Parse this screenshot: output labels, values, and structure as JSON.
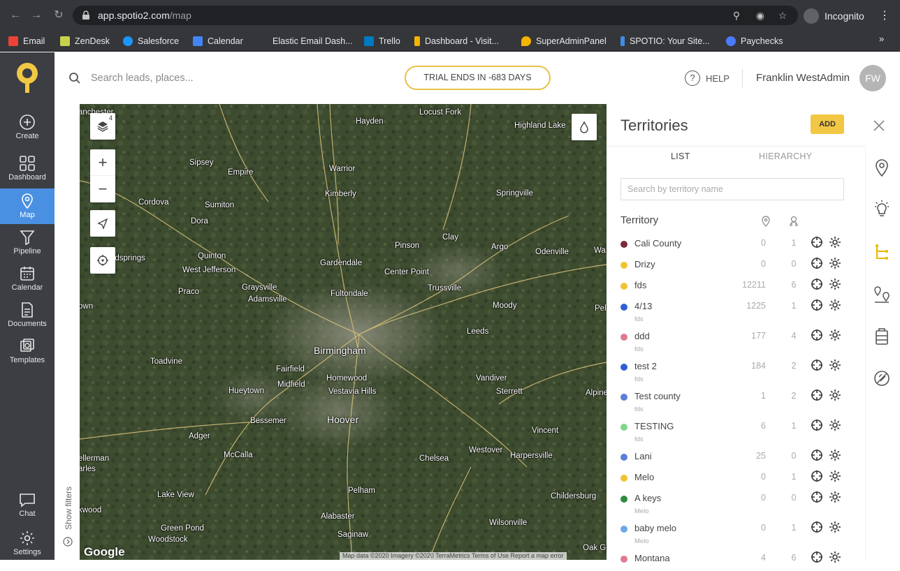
{
  "browser": {
    "url_host": "app.spotio2.com",
    "url_path": "/map",
    "profile_label": "Incognito",
    "bookmarks": [
      {
        "label": "Email",
        "color": "#ea4335"
      },
      {
        "label": "ZenDesk",
        "color": "#c6d24b"
      },
      {
        "label": "Salesforce",
        "color": "#1b96ff"
      },
      {
        "label": "Calendar",
        "color": "#4285f4"
      },
      {
        "label": "Elastic Email Dash...",
        "color": "#35363a"
      },
      {
        "label": "Trello",
        "color": "#0079bf"
      },
      {
        "label": "Dashboard - Visit...",
        "color": "#f4b400"
      },
      {
        "label": "SuperAdminPanel",
        "color": "#f4b400"
      },
      {
        "label": "SPOTIO: Your Site...",
        "color": "#3a8ee6"
      },
      {
        "label": "Paychecks",
        "color": "#4a7bff"
      }
    ],
    "more_label": "»"
  },
  "sidebar": {
    "items": [
      {
        "label": "Create",
        "icon": "plus-circle-icon"
      },
      {
        "label": "Dashboard",
        "icon": "grid-icon"
      },
      {
        "label": "Map",
        "icon": "map-pin-icon"
      },
      {
        "label": "Pipeline",
        "icon": "funnel-icon"
      },
      {
        "label": "Calendar",
        "icon": "calendar-icon"
      },
      {
        "label": "Documents",
        "icon": "document-icon"
      },
      {
        "label": "Templates",
        "icon": "templates-icon"
      }
    ],
    "bottom": [
      {
        "label": "Chat",
        "icon": "chat-icon"
      },
      {
        "label": "Settings",
        "icon": "gear-icon"
      }
    ]
  },
  "header": {
    "search_placeholder": "Search leads, places...",
    "trial_label": "TRIAL ENDS IN -683 DAYS",
    "help_label": "HELP",
    "user_name": "Franklin WestAdmin",
    "user_initials": "FW"
  },
  "map": {
    "layers_count": "4",
    "show_filters_label": "Show filters",
    "google_label": "Google",
    "attribution": "Map data ©2020 Imagery ©2020 TerraMetrics    Terms of Use    Report a map error",
    "cities": [
      {
        "name": "Locust Fork"
      },
      {
        "name": "Hayden"
      },
      {
        "name": "Highland Lake"
      },
      {
        "name": "Sipsey"
      },
      {
        "name": "Empire"
      },
      {
        "name": "Warrior"
      },
      {
        "name": "Kimberly"
      },
      {
        "name": "Springville"
      },
      {
        "name": "Cordova"
      },
      {
        "name": "Sumiton"
      },
      {
        "name": "Dora"
      },
      {
        "name": "Pinson"
      },
      {
        "name": "Clay"
      },
      {
        "name": "Argo"
      },
      {
        "name": "Odenville"
      },
      {
        "name": "Quinton"
      },
      {
        "name": "West Jefferson"
      },
      {
        "name": "Gardendale"
      },
      {
        "name": "Center Point"
      },
      {
        "name": "Praco"
      },
      {
        "name": "Graysville"
      },
      {
        "name": "Adamsville"
      },
      {
        "name": "Fultondale"
      },
      {
        "name": "Trussville"
      },
      {
        "name": "Moody"
      },
      {
        "name": "Leeds"
      },
      {
        "name": "Birmingham"
      },
      {
        "name": "Toadvine"
      },
      {
        "name": "Fairfield"
      },
      {
        "name": "Midfield"
      },
      {
        "name": "Homewood"
      },
      {
        "name": "Vestavia Hills"
      },
      {
        "name": "Vandiver"
      },
      {
        "name": "Sterrett"
      },
      {
        "name": "Hueytown"
      },
      {
        "name": "Bessemer"
      },
      {
        "name": "Hoover"
      },
      {
        "name": "Adger"
      },
      {
        "name": "Vincent"
      },
      {
        "name": "McCalla"
      },
      {
        "name": "Chelsea"
      },
      {
        "name": "Westover"
      },
      {
        "name": "Harpersville"
      },
      {
        "name": "Lake View"
      },
      {
        "name": "Pelham"
      },
      {
        "name": "Childersburg"
      },
      {
        "name": "Alabaster"
      },
      {
        "name": "Wilsonville"
      },
      {
        "name": "Green Pond"
      },
      {
        "name": "Woodstock"
      },
      {
        "name": "Saginaw"
      },
      {
        "name": "anchester"
      },
      {
        "name": "odsprings"
      },
      {
        "name": "own"
      },
      {
        "name": "Pel"
      },
      {
        "name": "Alpine"
      },
      {
        "name": "Wa"
      },
      {
        "name": "ellerman"
      },
      {
        "name": "arles"
      },
      {
        "name": "kwood"
      },
      {
        "name": "Oak Gr"
      }
    ]
  },
  "panel": {
    "title": "Territories",
    "add_label": "ADD",
    "tab_list": "LIST",
    "tab_hierarchy": "HIERARCHY",
    "search_placeholder": "Search by territory name",
    "col_territory": "Territory",
    "rows": [
      {
        "name": "Cali County",
        "sub": "",
        "count1": "0",
        "count2": "1",
        "color": "#7a2a3a"
      },
      {
        "name": "Drizy",
        "sub": "",
        "count1": "0",
        "count2": "0",
        "color": "#f0c431"
      },
      {
        "name": "fds",
        "sub": "",
        "count1": "12211",
        "count2": "6",
        "color": "#f0c431"
      },
      {
        "name": "4/13",
        "sub": "fds",
        "count1": "1225",
        "count2": "1",
        "color": "#2f5ed6"
      },
      {
        "name": "ddd",
        "sub": "fds",
        "count1": "177",
        "count2": "4",
        "color": "#e07a8e"
      },
      {
        "name": "test 2",
        "sub": "fds",
        "count1": "184",
        "count2": "2",
        "color": "#2f5ed6"
      },
      {
        "name": "Test county",
        "sub": "fds",
        "count1": "1",
        "count2": "2",
        "color": "#5b7fd6"
      },
      {
        "name": "TESTING",
        "sub": "fds",
        "count1": "6",
        "count2": "1",
        "color": "#7fd68c"
      },
      {
        "name": "Lani",
        "sub": "",
        "count1": "25",
        "count2": "0",
        "color": "#5b7fd6"
      },
      {
        "name": "Melo",
        "sub": "",
        "count1": "0",
        "count2": "1",
        "color": "#f0c431"
      },
      {
        "name": "A keys",
        "sub": "Melo",
        "count1": "0",
        "count2": "0",
        "color": "#2f8a44"
      },
      {
        "name": "baby melo",
        "sub": "Melo",
        "count1": "0",
        "count2": "1",
        "color": "#6aa8e8"
      },
      {
        "name": "Montana",
        "sub": "",
        "count1": "4",
        "count2": "6",
        "color": "#e07a8e"
      }
    ]
  },
  "colors": {
    "accent": "#f2c744",
    "sidebar_bg": "#3c3e43",
    "active_nav": "#4a90e2",
    "teal_rail": "#e8b800"
  }
}
